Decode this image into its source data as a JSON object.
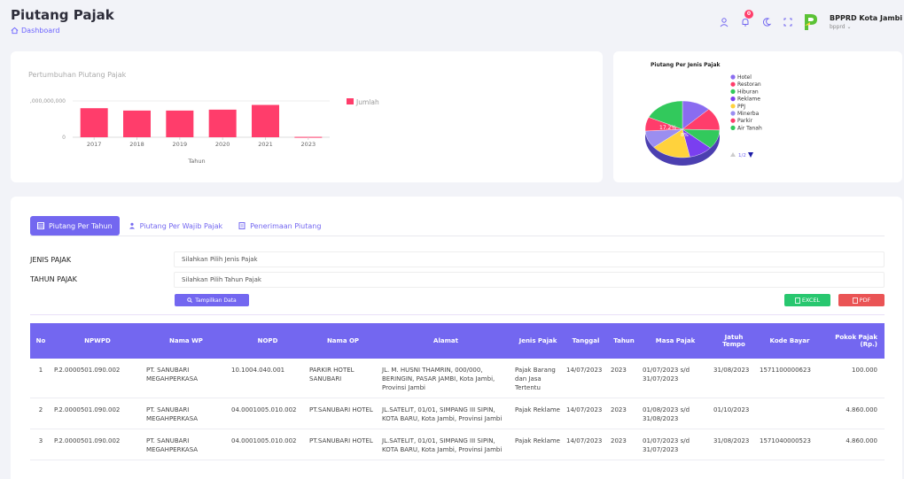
{
  "header": {
    "title": "Piutang Pajak",
    "breadcrumb": "Dashboard",
    "notification_count": "0",
    "user_name": "BPPRD Kota Jambi",
    "user_role": "bpprd ⌄"
  },
  "growth_chart": {
    "title": "Pertumbuhan Piutang Pajak",
    "legend": "Jumlah"
  },
  "pie_chart": {
    "title": "Piutang Per Jenis Pajak",
    "legend": [
      "Hotel",
      "Restoran",
      "Hiburan",
      "Reklame",
      "PPJ",
      "Minerba",
      "Parkir",
      "Air Tanah"
    ],
    "colors": [
      "#8a6cf0",
      "#ff3d6b",
      "#32c95c",
      "#7a3ff0",
      "#ffd23c",
      "#9b8ef0",
      "#ff3d6b",
      "#32c95c"
    ],
    "label_a": "17.2%",
    "label_b": "8%",
    "pagination": "1/2"
  },
  "chart_data": [
    {
      "type": "bar",
      "title": "Pertumbuhan Piutang Pajak",
      "categories": [
        "2017",
        "2018",
        "2019",
        "2020",
        "2021",
        "2023"
      ],
      "series": [
        {
          "name": "Jumlah",
          "values": [
            1600000000,
            1470000000,
            1470000000,
            1520000000,
            1780000000,
            20000000
          ]
        }
      ],
      "xlabel": "Tahun",
      "ylabel": "",
      "y_tick_labels": [
        "0",
        ",000,000,000"
      ],
      "ylim": [
        0,
        2000000000
      ],
      "color": "#ff3d6b",
      "legend_position": "right"
    },
    {
      "type": "pie",
      "title": "Piutang Per Jenis Pajak",
      "categories": [
        "Hotel",
        "Restoran",
        "Hiburan",
        "Reklame",
        "PPJ",
        "Minerba",
        "Parkir",
        "Air Tanah"
      ],
      "values": [
        12.5,
        13,
        11,
        10.3,
        17.2,
        10,
        8,
        18
      ],
      "colors": [
        "#8a6cf0",
        "#ff3d6b",
        "#32c95c",
        "#7a3ff0",
        "#ffd23c",
        "#9b8ef0",
        "#ff3d6b",
        "#32c95c"
      ],
      "legend_position": "right"
    }
  ],
  "tabs": [
    {
      "label": "Piutang Per Tahun",
      "active": true
    },
    {
      "label": "Piutang Per Wajib Pajak",
      "active": false
    },
    {
      "label": "Penerimaan Piutang",
      "active": false
    }
  ],
  "form": {
    "jenis_label": "JENIS PAJAK",
    "jenis_value": "Silahkan Pilih Jenis Pajak",
    "tahun_label": "TAHUN PAJAK",
    "tahun_value": "Silahkan Pilih Tahun Pajak",
    "show_button": "Tampilkan Data",
    "excel_button": "EXCEL",
    "pdf_button": "PDF"
  },
  "table": {
    "columns": [
      "No",
      "NPWPD",
      "Nama WP",
      "NOPD",
      "Nama OP",
      "Alamat",
      "Jenis Pajak",
      "Tanggal",
      "Tahun",
      "Masa Pajak",
      "Jatuh Tempo",
      "Kode Bayar",
      "Pokok Pajak (Rp.)"
    ],
    "rows": [
      [
        "1",
        "P.2.0000501.090.002",
        "PT. SANUBARI MEGAHPERKASA",
        "10.1004.040.001",
        "PARKIR HOTEL SANUBARI",
        "JL. M. HUSNI THAMRIN, 000/000, BERINGIN, PASAR JAMBI, Kota Jambi, Provinsi Jambi",
        "Pajak Barang dan Jasa Tertentu",
        "14/07/2023",
        "2023",
        "01/07/2023 s/d 31/07/2023",
        "31/08/2023",
        "1571100000623",
        "100.000"
      ],
      [
        "2",
        "P.2.0000501.090.002",
        "PT. SANUBARI MEGAHPERKASA",
        "04.0001005.010.002",
        "PT.SANUBARI HOTEL",
        "JL.SATELIT, 01/01, SIMPANG III SIPIN, KOTA BARU, Kota Jambi, Provinsi Jambi",
        "Pajak Reklame",
        "14/07/2023",
        "2023",
        "01/08/2023 s/d 31/08/2023",
        "01/10/2023",
        "",
        "4.860.000"
      ],
      [
        "3",
        "P.2.0000501.090.002",
        "PT. SANUBARI MEGAHPERKASA",
        "04.0001005.010.002",
        "PT.SANUBARI HOTEL",
        "JL.SATELIT, 01/01, SIMPANG III SIPIN, KOTA BARU, Kota Jambi, Provinsi Jambi",
        "Pajak Reklame",
        "14/07/2023",
        "2023",
        "01/07/2023 s/d 31/07/2023",
        "31/08/2023",
        "1571040000523",
        "4.860.000"
      ]
    ]
  }
}
